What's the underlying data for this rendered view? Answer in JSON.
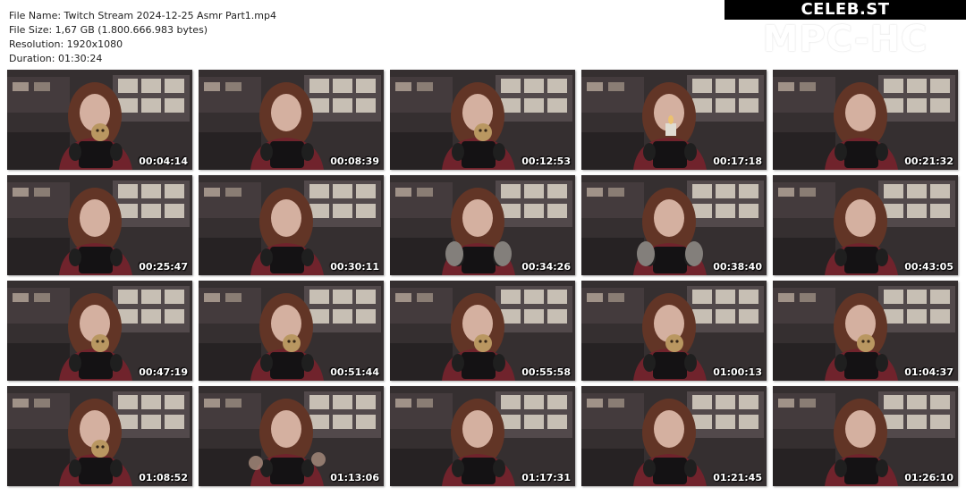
{
  "file_info": {
    "file_name": "File Name: Twitch Stream 2024-12-25 Asmr Part1.mp4",
    "file_size": "File Size: 1,67 GB (1.800.666.983 bytes)",
    "resolution": "Resolution: 1920x1080",
    "duration": "Duration: 01:30:24"
  },
  "branding": {
    "site": "CELEB.ST",
    "app": "MPC-HC"
  },
  "thumbnails": [
    {
      "time": "00:04:14",
      "prop": "doll"
    },
    {
      "time": "00:08:39",
      "prop": "none"
    },
    {
      "time": "00:12:53",
      "prop": "doll"
    },
    {
      "time": "00:17:18",
      "prop": "candle"
    },
    {
      "time": "00:21:32",
      "prop": "none"
    },
    {
      "time": "00:25:47",
      "prop": "none"
    },
    {
      "time": "00:30:11",
      "prop": "none"
    },
    {
      "time": "00:34:26",
      "prop": "fluffy"
    },
    {
      "time": "00:38:40",
      "prop": "fluffy"
    },
    {
      "time": "00:43:05",
      "prop": "none"
    },
    {
      "time": "00:47:19",
      "prop": "doll"
    },
    {
      "time": "00:51:44",
      "prop": "doll"
    },
    {
      "time": "00:55:58",
      "prop": "doll"
    },
    {
      "time": "01:00:13",
      "prop": "doll"
    },
    {
      "time": "01:04:37",
      "prop": "doll"
    },
    {
      "time": "01:08:52",
      "prop": "doll"
    },
    {
      "time": "01:13:06",
      "prop": "glass"
    },
    {
      "time": "01:17:31",
      "prop": "none"
    },
    {
      "time": "01:21:45",
      "prop": "none"
    },
    {
      "time": "01:26:10",
      "prop": "none"
    }
  ],
  "colors": {
    "header_bar": "#000000",
    "timestamp_text": "#ffffff",
    "room_wall": "#3a3335",
    "shelf_light": "#efe6d8",
    "hair": "#6b3a2a",
    "shirt": "#7a2630",
    "skin": "#e7bfae",
    "mic": "#161416"
  }
}
